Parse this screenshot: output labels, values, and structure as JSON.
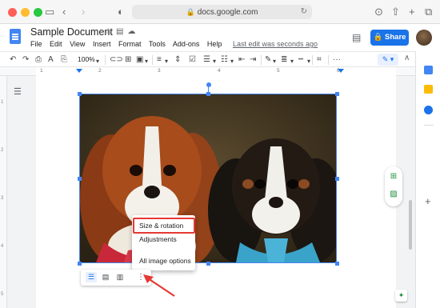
{
  "browser": {
    "url": "docs.google.com",
    "lock_icon": "lock-icon"
  },
  "doc": {
    "title": "Sample Document",
    "menu": [
      "File",
      "Edit",
      "View",
      "Insert",
      "Format",
      "Tools",
      "Add-ons",
      "Help"
    ],
    "last_edit": "Last edit was seconds ago",
    "share_label": "Share"
  },
  "toolbar": {
    "zoom": "100%"
  },
  "ruler": {
    "ticks": [
      "1",
      "2",
      "3",
      "4",
      "5",
      "6"
    ]
  },
  "vruler": {
    "ticks": [
      "1",
      "2",
      "3",
      "4",
      "5"
    ]
  },
  "image_context_menu": {
    "items": [
      "Size & rotation",
      "Adjustments",
      "All image options"
    ],
    "highlighted": "Size & rotation"
  },
  "colors": {
    "accent": "#1a73e8",
    "highlight_box": "#e53935",
    "arrow": "#e53935"
  }
}
